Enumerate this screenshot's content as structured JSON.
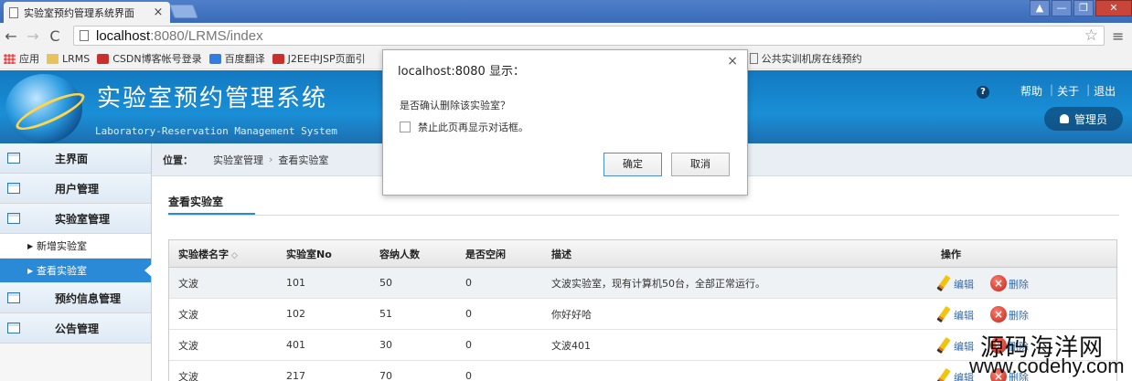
{
  "browser": {
    "tab_title": "实验室预约管理系统界面",
    "tab_close": "×",
    "url_host": "localhost",
    "url_path": ":8080/LRMS/index",
    "win_controls": [
      "▲",
      "—",
      "❐",
      "✕"
    ],
    "bookmarks": [
      {
        "label": "应用",
        "icon": "apps-icon"
      },
      {
        "label": "LRMS",
        "icon": "folder-icon"
      },
      {
        "label": "CSDN博客帐号登录",
        "icon": "csdn-icon"
      },
      {
        "label": "百度翻译",
        "icon": "fanyi-icon"
      },
      {
        "label": "J2EE中JSP页面引",
        "icon": "csdn-icon"
      },
      {
        "label": "公共实训机房在线预约",
        "icon": "doc-icon"
      }
    ]
  },
  "header": {
    "title": "实验室预约管理系统",
    "subtitle": "Laboratory-Reservation Management System",
    "help_icon": "?",
    "links": [
      "帮助",
      "关于",
      "退出"
    ],
    "admin": "管理员"
  },
  "sidebar": {
    "items": [
      {
        "label": "主界面"
      },
      {
        "label": "用户管理"
      },
      {
        "label": "实验室管理"
      }
    ],
    "sub_items": [
      {
        "label": "新增实验室",
        "active": false
      },
      {
        "label": "查看实验室",
        "active": true
      }
    ],
    "items_after": [
      {
        "label": "预约信息管理"
      },
      {
        "label": "公告管理"
      }
    ]
  },
  "breadcrumb": {
    "label": "位置：",
    "path": [
      "实验室管理",
      "查看实验室"
    ],
    "separator": "›"
  },
  "section": {
    "title": "查看实验室"
  },
  "table": {
    "headers": [
      "实验楼名字",
      "实验室No",
      "容纳人数",
      "是否空闲",
      "描述",
      "操作"
    ],
    "sort_glyph": "◇",
    "edit_label": "编辑",
    "delete_label": "删除",
    "delete_glyph": "×",
    "rows": [
      [
        "文波",
        "101",
        "50",
        "0",
        "文波实验室，现有计算机50台，全部正常运行。"
      ],
      [
        "文波",
        "102",
        "51",
        "0",
        "你好好哈"
      ],
      [
        "文波",
        "401",
        "30",
        "0",
        "文波401"
      ],
      [
        "文波",
        "217",
        "70",
        "0",
        ""
      ]
    ]
  },
  "dialog": {
    "title": "localhost:8080 显示：",
    "close": "×",
    "message": "是否确认删除该实验室？",
    "checkbox_label": "禁止此页再显示对话框。",
    "ok": "确定",
    "cancel": "取消"
  },
  "watermark": {
    "line1": "源码海洋网",
    "line2": "www.codehy.com"
  },
  "colors": {
    "accent": "#2b8ad8",
    "header": "#1a8fd6",
    "link": "#2a6ebb"
  }
}
